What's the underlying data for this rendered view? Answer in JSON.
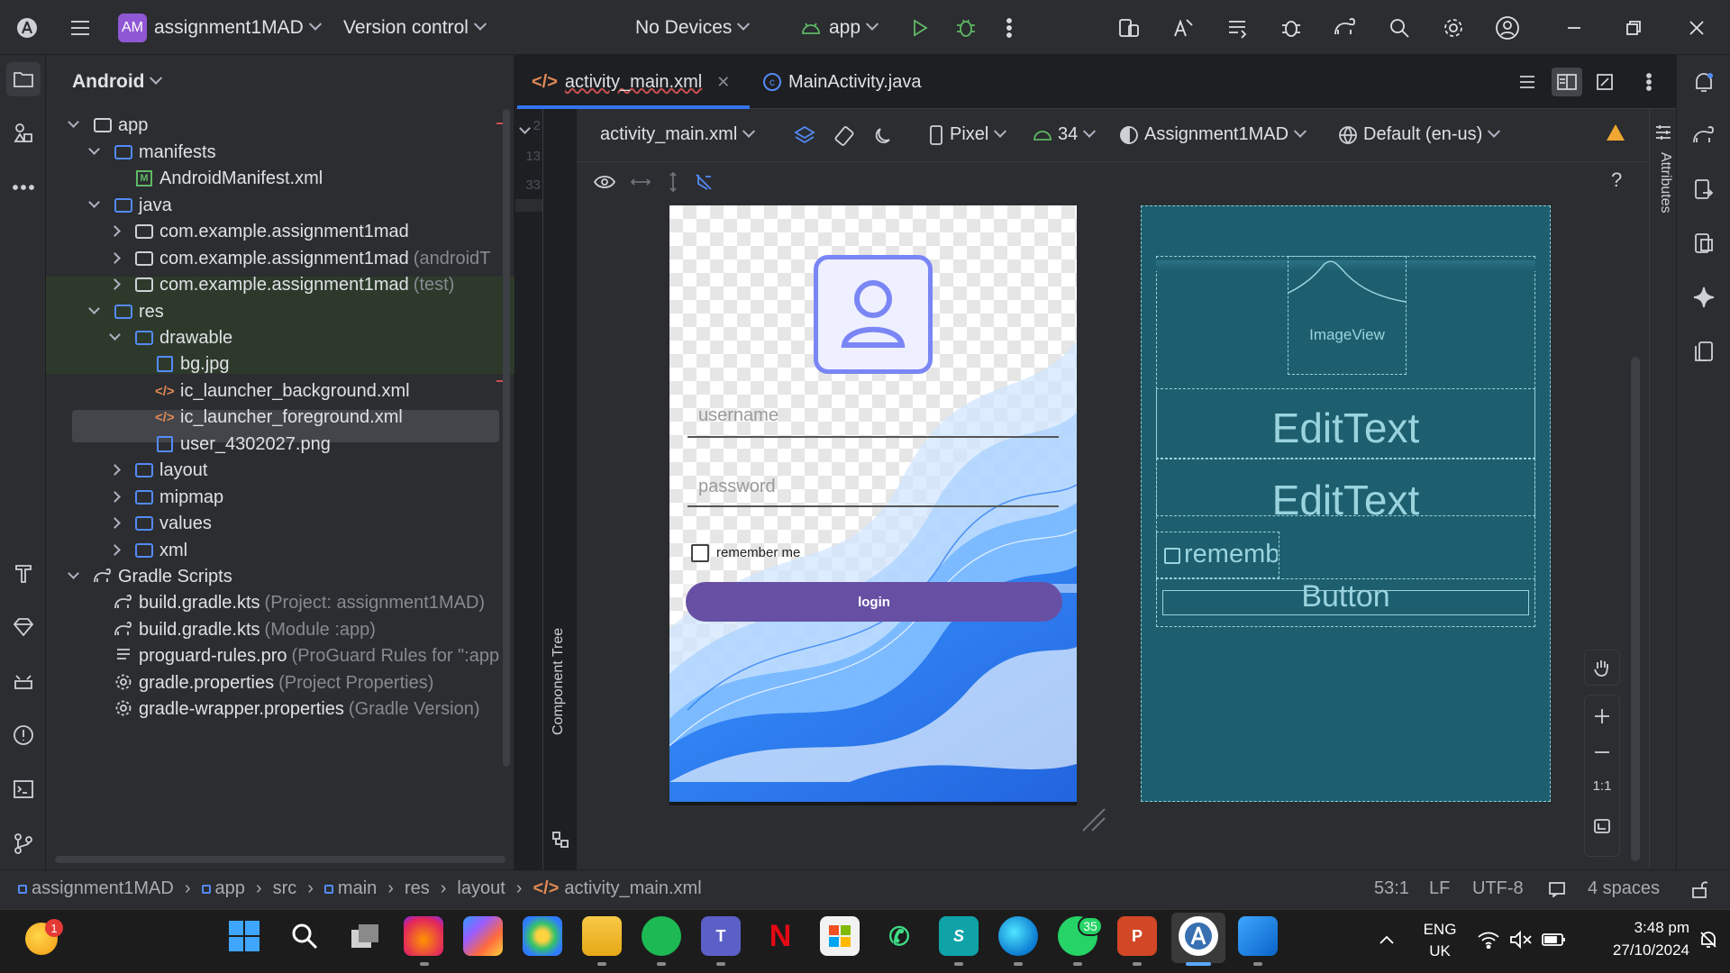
{
  "titlebar": {
    "project_badge": "AM",
    "project_name": "assignment1MAD",
    "vcs": "Version control",
    "devices": "No Devices",
    "run_config": "app"
  },
  "project_panel": {
    "view_mode": "Android",
    "tree": [
      {
        "label": "app",
        "hint": "",
        "icon": "app-module-icon"
      },
      {
        "label": "manifests",
        "hint": "",
        "icon": "folder-icon"
      },
      {
        "label": "AndroidManifest.xml",
        "hint": "",
        "icon": "manifest-file-icon"
      },
      {
        "label": "java",
        "hint": "",
        "icon": "folder-icon"
      },
      {
        "label": "com.example.assignment1mad",
        "hint": "",
        "icon": "package-icon"
      },
      {
        "label": "com.example.assignment1mad",
        "hint": "(androidT",
        "icon": "package-icon"
      },
      {
        "label": "com.example.assignment1mad",
        "hint": "(test)",
        "icon": "package-icon"
      },
      {
        "label": "res",
        "hint": "",
        "icon": "folder-icon"
      },
      {
        "label": "drawable",
        "hint": "",
        "icon": "folder-icon"
      },
      {
        "label": "bg.jpg",
        "hint": "",
        "icon": "image-file-icon"
      },
      {
        "label": "ic_launcher_background.xml",
        "hint": "",
        "icon": "xml-file-icon"
      },
      {
        "label": "ic_launcher_foreground.xml",
        "hint": "",
        "icon": "xml-file-icon"
      },
      {
        "label": "user_4302027.png",
        "hint": "",
        "icon": "image-file-icon"
      },
      {
        "label": "layout",
        "hint": "",
        "icon": "folder-icon"
      },
      {
        "label": "mipmap",
        "hint": "",
        "icon": "folder-icon"
      },
      {
        "label": "values",
        "hint": "",
        "icon": "folder-icon"
      },
      {
        "label": "xml",
        "hint": "",
        "icon": "folder-icon"
      },
      {
        "label": "Gradle Scripts",
        "hint": "",
        "icon": "gradle-icon"
      },
      {
        "label": "build.gradle.kts",
        "hint": "(Project: assignment1MAD)",
        "icon": "gradle-file-icon"
      },
      {
        "label": "build.gradle.kts",
        "hint": "(Module :app)",
        "icon": "gradle-file-icon"
      },
      {
        "label": "proguard-rules.pro",
        "hint": "(ProGuard Rules for \":app",
        "icon": "text-file-icon"
      },
      {
        "label": "gradle.properties",
        "hint": "(Project Properties)",
        "icon": "settings-file-icon"
      },
      {
        "label": "gradle-wrapper.properties",
        "hint": "(Gradle Version)",
        "icon": "settings-file-icon"
      }
    ]
  },
  "editor": {
    "tabs": [
      {
        "label": "activity_main.xml",
        "active": true
      },
      {
        "label": "MainActivity.java",
        "active": false
      }
    ],
    "gutter_numbers": [
      "2",
      "13",
      "33"
    ],
    "design_toolbar": {
      "file": "activity_main.xml",
      "device": "Pixel",
      "api": "34",
      "theme": "Assignment1MAD",
      "locale": "Default (en-us)"
    },
    "side_tabs": {
      "component_tree": "Component Tree",
      "attributes": "Attributes"
    },
    "help": "?"
  },
  "preview": {
    "username_hint": "username",
    "password_hint": "password",
    "remember_label": "remember me",
    "login_label": "login",
    "accent": "#6750a4"
  },
  "blueprint": {
    "image_label": "ImageView",
    "edit1": "EditText",
    "edit2": "EditText",
    "checkbox": "rememb",
    "button": "Button"
  },
  "zoom": {
    "ratio": "1:1"
  },
  "statusbar": {
    "breadcrumbs": [
      "assignment1MAD",
      "app",
      "src",
      "main",
      "res",
      "layout",
      "activity_main.xml"
    ],
    "position": "53:1",
    "line_sep": "LF",
    "encoding": "UTF-8",
    "indent": "4 spaces"
  },
  "taskbar": {
    "weather_badge": "1",
    "whatsapp_badge": "35",
    "lang": "ENG",
    "region": "UK",
    "time": "3:48 pm",
    "date": "27/10/2024"
  }
}
